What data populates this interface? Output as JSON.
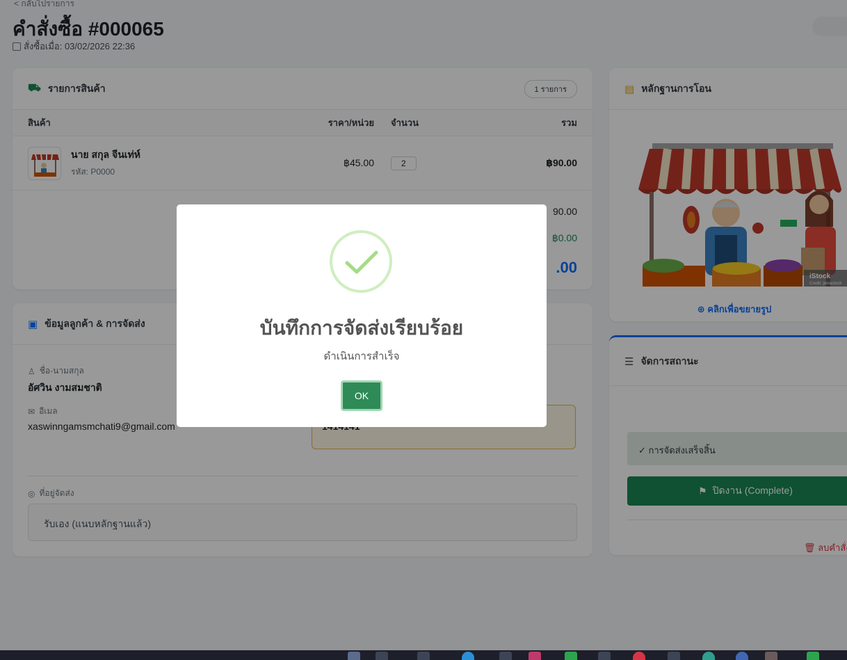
{
  "header": {
    "back_label": "< กลับไปรายการ",
    "order_title": "คำสั่งซื้อ #000065",
    "order_date": "สั่งซื้อเมื่อ: 03/02/2026 22:36"
  },
  "products_card": {
    "title": "รายการสินค้า",
    "count_badge": "1 รายการ",
    "columns": {
      "product": "สินค้า",
      "unit_price": "ราคา/หน่วย",
      "quantity": "จำนวน",
      "total": "รวม"
    },
    "items": [
      {
        "name": "นาย สกุล จีนเท่ห์",
        "code": "รหัส: P0000",
        "unit_price": "฿45.00",
        "quantity": "2",
        "total": "฿90.00"
      }
    ],
    "summary": {
      "subtotal": "90.00",
      "discount": "฿0.00",
      "grand_total": ".00"
    }
  },
  "customer_card": {
    "title": "ข้อมูลลูกค้า & การจัดส่ง",
    "name_label": "ชื่อ-นามสกุล",
    "name_value": "อัศวิน งามสมชาติ",
    "email_label": "อีเมล",
    "email_value": "xaswinngamsmchati9@gmail.com",
    "tracking_value": "1414141",
    "address_label": "ที่อยู่จัดส่ง",
    "address_value": "รับเอง (แนบหลักฐานแล้ว)"
  },
  "slip_card": {
    "title": "หลักฐานการโอน",
    "image_watermark": "iStock",
    "image_credit": "Credit: jemastock",
    "zoom_label": "คลิกเพื่อขยายรูป"
  },
  "status_card": {
    "title": "จัดการสถานะ",
    "current_status": "✓ การจัดส่งเสร็จสิ้น",
    "complete_button": "ปิดงาน (Complete)",
    "delete_link": "ลบคำสั่ง"
  },
  "modal": {
    "title": "บันทึกการจัดส่งเรียบร้อย",
    "message": "ดำเนินการสำเร็จ",
    "ok_label": "OK"
  },
  "colors": {
    "primary": "#0d6efd",
    "success": "#198754",
    "danger": "#dc3545",
    "warning": "#e0b84c"
  }
}
